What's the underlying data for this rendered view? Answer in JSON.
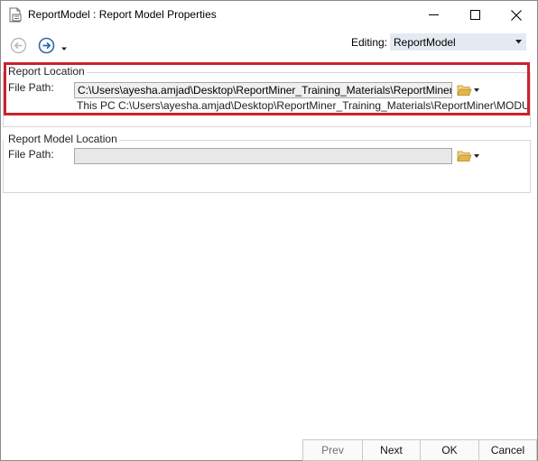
{
  "window": {
    "title": "ReportModel : Report Model Properties"
  },
  "toolbar": {
    "editing_label": "Editing:",
    "editing_value": "ReportModel"
  },
  "report_location": {
    "title": "Report Location",
    "file_path_label": "File Path:",
    "file_path_value": "C:\\Users\\ayesha.amjad\\Desktop\\ReportMiner_Training_Materials\\ReportMiner\\MODU",
    "resolved_hint": "This PC C:\\Users\\ayesha.amjad\\Desktop\\ReportMiner_Training_Materials\\ReportMiner\\MODU"
  },
  "report_model_location": {
    "title": "Report Model Location",
    "file_path_label": "File Path:",
    "file_path_value": ""
  },
  "footer": {
    "prev": "Prev",
    "next": "Next",
    "ok": "OK",
    "cancel": "Cancel"
  },
  "colors": {
    "highlight": "#cc2229",
    "nav_blue": "#2d6aa8",
    "folder": "#e3b64a"
  },
  "icons": {
    "app": "report-model-icon",
    "back": "back-arrow-icon",
    "forward": "forward-arrow-icon",
    "browse": "folder-icon"
  }
}
